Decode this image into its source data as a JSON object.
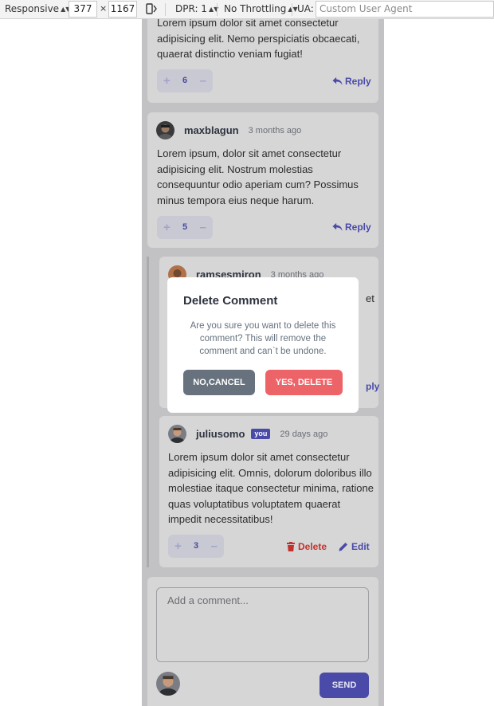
{
  "devtools": {
    "device_mode": "Responsive",
    "width": "377",
    "times": "×",
    "height": "1167",
    "dpr": "DPR: 1",
    "throttling": "No Throttling",
    "ua_label": "UA:",
    "ua_placeholder": "Custom User Agent"
  },
  "comments": [
    {
      "body": "Lorem ipsum dolor sit amet consectetur adipisicing elit. Nemo perspiciatis obcaecati, quaerat distinctio veniam fugiat!",
      "score": "6",
      "reply_label": "Reply"
    },
    {
      "username": "maxblagun",
      "date": "3 months ago",
      "body": "Lorem ipsum, dolor sit amet consectetur adipisicing elit. Nostrum molestias consequuntur odio aperiam cum? Possimus minus tempora eius neque harum.",
      "score": "5",
      "reply_label": "Reply"
    }
  ],
  "replies": [
    {
      "username": "ramsesmiron",
      "date": "3 months ago",
      "body_fragment": "et",
      "reply_fragment": "ply"
    },
    {
      "username": "juliusomo",
      "you_badge": "you",
      "date": "29 days ago",
      "body": "Lorem ipsum dolor sit amet consectetur adipisicing elit. Omnis, dolorum doloribus illo molestiae itaque consectetur minima, ratione quas voluptatibus voluptatem quaerat impedit necessitatibus!",
      "score": "3",
      "delete_label": "Delete",
      "edit_label": "Edit"
    }
  ],
  "composer": {
    "placeholder": "Add a comment...",
    "send_label": "SEND"
  },
  "modal": {
    "title": "Delete Comment",
    "text": "Are you sure you want to delete this comment? This will remove the comment and can`t be undone.",
    "cancel_label": "NO,CANCEL",
    "confirm_label": "YES, DELETE"
  },
  "colors": {
    "accent": "#4a4aa8",
    "danger": "#ed6468",
    "neutral_button": "#67727e"
  }
}
